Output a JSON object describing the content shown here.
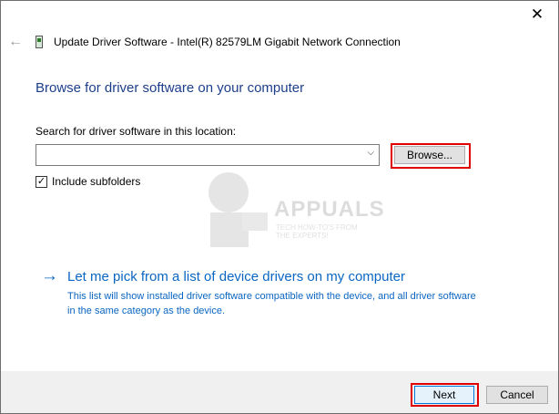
{
  "window": {
    "close_glyph": "✕"
  },
  "nav": {
    "back_glyph": "←",
    "device_icon": "network-adapter-icon",
    "title": "Update Driver Software - Intel(R) 82579LM Gigabit Network Connection"
  },
  "content": {
    "heading": "Browse for driver software on your computer",
    "search_label": "Search for driver software in this location:",
    "search_value": "",
    "combo_arrow": "⌵",
    "browse_label": "Browse...",
    "include_subfolders_label": "Include subfolders",
    "include_subfolders_checked": true,
    "check_glyph": "✓",
    "link_arrow": "→",
    "link_title": "Let me pick from a list of device drivers on my computer",
    "link_description": "This list will show installed driver software compatible with the device, and all driver software in the same category as the device."
  },
  "watermark": {
    "brand": "APPUALS",
    "tagline": "TECH HOW-TO'S FROM THE EXPERTS!"
  },
  "footer": {
    "next_label": "Next",
    "cancel_label": "Cancel"
  },
  "colors": {
    "heading": "#1d3f8a",
    "link": "#0a66c2",
    "highlight": "#e00000",
    "footer_bg": "#f0f0f0"
  }
}
